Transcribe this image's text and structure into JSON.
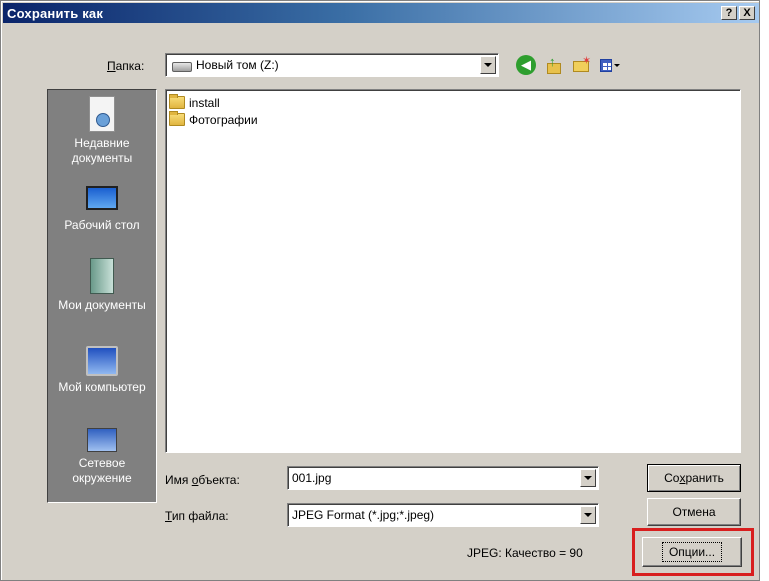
{
  "window": {
    "title": "Сохранить как",
    "help_button": "?",
    "close_button": "X"
  },
  "lookin": {
    "label_accel": "П",
    "label_rest": "апка:",
    "value": "Новый том (Z:)"
  },
  "toolbar": {
    "icons": [
      "back-icon",
      "up-folder-icon",
      "new-folder-icon",
      "view-menu-icon"
    ]
  },
  "places": [
    {
      "label": "Недавние документы",
      "icon": "recent-documents-icon"
    },
    {
      "label": "Рабочий стол",
      "icon": "desktop-icon"
    },
    {
      "label": "Мои документы",
      "icon": "my-documents-icon"
    },
    {
      "label": "Мой компьютер",
      "icon": "my-computer-icon"
    },
    {
      "label": "Сетевое окружение",
      "icon": "network-icon"
    }
  ],
  "files": [
    {
      "name": "install",
      "icon": "folder-icon"
    },
    {
      "name": "Фотографии",
      "icon": "folder-icon"
    }
  ],
  "filename": {
    "label_pre": "Имя ",
    "label_accel": "о",
    "label_post": "бъекта:",
    "value": "001.jpg"
  },
  "filetype": {
    "label_accel": "Т",
    "label_post": "ип файла:",
    "value": "JPEG Format (*.jpg;*.jpeg)"
  },
  "buttons": {
    "save_pre": "Со",
    "save_accel": "х",
    "save_post": "ранить",
    "cancel": "Отмена",
    "options": "Опции..."
  },
  "quality_text": "JPEG: Качество = 90",
  "colors": {
    "highlight": "#d81e1e",
    "titlebar": "#0a246a"
  }
}
